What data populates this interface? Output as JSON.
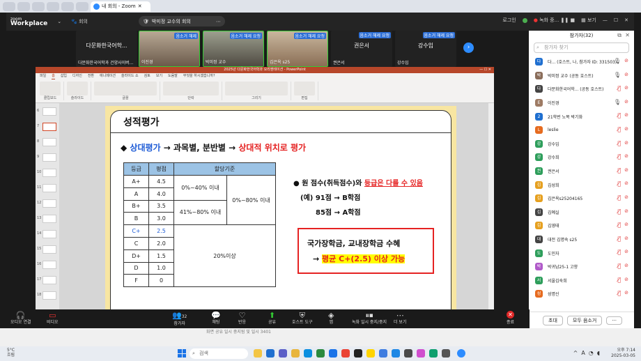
{
  "browser": {
    "tab_label": "내 회의 - Zoom"
  },
  "zoom": {
    "logo_line1": "zoom",
    "logo_line2": "Workplace",
    "meetings_label": "회의",
    "meeting_title": "박미정 교수의 회의",
    "login": "로그인",
    "recording": "녹화 중...",
    "view": "보기"
  },
  "videos": [
    {
      "name": "다문화한국어학...",
      "caption": "다문화한국어학과 건양사이버...",
      "request": "",
      "camera": false
    },
    {
      "name": "",
      "caption": "이진경",
      "request": "음소거 해제",
      "camera": true
    },
    {
      "name": "",
      "caption": "박미정 교수",
      "request": "음소거 해제 요청",
      "camera": true
    },
    {
      "name": "",
      "caption": "김은옥 s25",
      "request": "음소거 해제 요청",
      "camera": true
    },
    {
      "name": "권은서",
      "caption": "권은서",
      "request": "음소거 해제 요청",
      "camera": false
    },
    {
      "name": "강수임",
      "caption": "강수임",
      "request": "음소거 해제 요청",
      "camera": false
    }
  ],
  "ppt": {
    "doc_title": "2025년 다문화한국어학과 오리엔테이션 - PowerPoint",
    "window_controls": "— ☐ ✕",
    "tabs": [
      "파일",
      "홈",
      "삽입",
      "디자인",
      "전환",
      "애니메이션",
      "슬라이드 쇼",
      "검토",
      "보기",
      "도움말",
      "무엇을 하시겠습니까?"
    ],
    "ribbon_groups": [
      "클립보드",
      "슬라이드",
      "글꼴",
      "단락",
      "그리기",
      "편집"
    ],
    "thumbs": [
      "6",
      "7",
      "8",
      "9",
      "10",
      "11",
      "12",
      "13",
      "14",
      "15",
      "16",
      "17",
      "18"
    ]
  },
  "slide": {
    "title": "성적평가",
    "line_prefix": "◆ ",
    "line_a": "상대평가",
    "line_b": " → 과목별, 분반별 → ",
    "line_c": "상대적 위치로 평가",
    "table": {
      "headers": [
        "등급",
        "평점",
        "할당기준"
      ],
      "grades": [
        "A+",
        "A",
        "B+",
        "B",
        "C+",
        "C",
        "D+",
        "D",
        "F"
      ],
      "points": [
        "4.5",
        "4.0",
        "3.5",
        "3.0",
        "2.5",
        "2.0",
        "1.5",
        "1.0",
        "0"
      ],
      "band_a": "0%~40% 이내",
      "band_b": "41%~80% 이내",
      "band_ab": "0%~80% 이내",
      "band_rest": "20%이상"
    },
    "bullet_prefix": "●  원 점수(취득점수)와 ",
    "bullet_red": "등급은 다를 수 있음",
    "ex1": "(예) 91점 → B학점",
    "ex2": "85점 → A학점",
    "box_line1": "국가장학금, 교내장학금 수혜",
    "box_arrow": "→ ",
    "box_hl": "평균 C+(2.5) 이상 가능"
  },
  "panel": {
    "title": "참가자(32)",
    "search_placeholder": "참가자 찾기",
    "invite": "초대",
    "mute_all": "모두 음소거",
    "more": "···",
    "participants": [
      {
        "initial": "다",
        "name": "다...  (호스트, 나, 참가자 ID: 331503)",
        "color": "#1f6fd0",
        "status": "mic-on"
      },
      {
        "initial": "박",
        "name": "박미정 교수 (공동 호스트)",
        "color": "#8a6d5a",
        "status": "mic-on"
      },
      {
        "initial": "다",
        "name": "다문화한국어학... (공동 호스트)",
        "color": "#444444",
        "status": "muted"
      },
      {
        "initial": "E",
        "name": "이진경",
        "color": "#9e7b64",
        "status": "mic-on"
      },
      {
        "initial": "2",
        "name": "21학번 노목 박기화",
        "color": "#1f6fd0",
        "status": "muted"
      },
      {
        "initial": "L",
        "name": "leslie",
        "color": "#e66b1f",
        "status": "muted"
      },
      {
        "initial": "강",
        "name": "강수임",
        "color": "#2e9e5b",
        "status": "muted"
      },
      {
        "initial": "강",
        "name": "강수희",
        "color": "#2e9e5b",
        "status": "muted"
      },
      {
        "initial": "권",
        "name": "권은서",
        "color": "#2e9e5b",
        "status": "muted"
      },
      {
        "initial": "김",
        "name": "김성희",
        "color": "#e6a01f",
        "status": "muted"
      },
      {
        "initial": "김",
        "name": "김은옥s25204165",
        "color": "#e6a01f",
        "status": "muted"
      },
      {
        "initial": "김",
        "name": "김예실",
        "color": "#444444",
        "status": "muted"
      },
      {
        "initial": "김",
        "name": "김영태",
        "color": "#e6a01f",
        "status": "muted"
      },
      {
        "initial": "대",
        "name": "대전 김명숙 s25",
        "color": "#444444",
        "status": "muted"
      },
      {
        "initial": "도",
        "name": "도민자",
        "color": "#2e9e5b",
        "status": "muted"
      },
      {
        "initial": "박",
        "name": "박귀남25-1 고향",
        "color": "#b05ac9",
        "status": "muted"
      },
      {
        "initial": "서",
        "name": "서울김숙희",
        "color": "#2e9e5b",
        "status": "muted"
      },
      {
        "initial": "성",
        "name": "성명신",
        "color": "#e66b1f",
        "status": "muted"
      }
    ]
  },
  "toolbar": {
    "audio": "오디오 연결",
    "video": "비디오",
    "participants": "참가자",
    "participants_count": "32",
    "chat": "채팅",
    "react": "반응",
    "share": "공유",
    "host_tools": "호스트 도구",
    "apps": "앱",
    "record": "녹화 일시 중지/중지",
    "more": "더 보기",
    "end": "종료"
  },
  "desktop": {
    "tip": "화면 공유 일시 중지됨 및 일시 3401"
  },
  "taskbar": {
    "temp": "5°C",
    "weather": "흐림",
    "search": "검색",
    "time": "오후 7:14",
    "date": "2025-03-05",
    "lang": "A"
  }
}
